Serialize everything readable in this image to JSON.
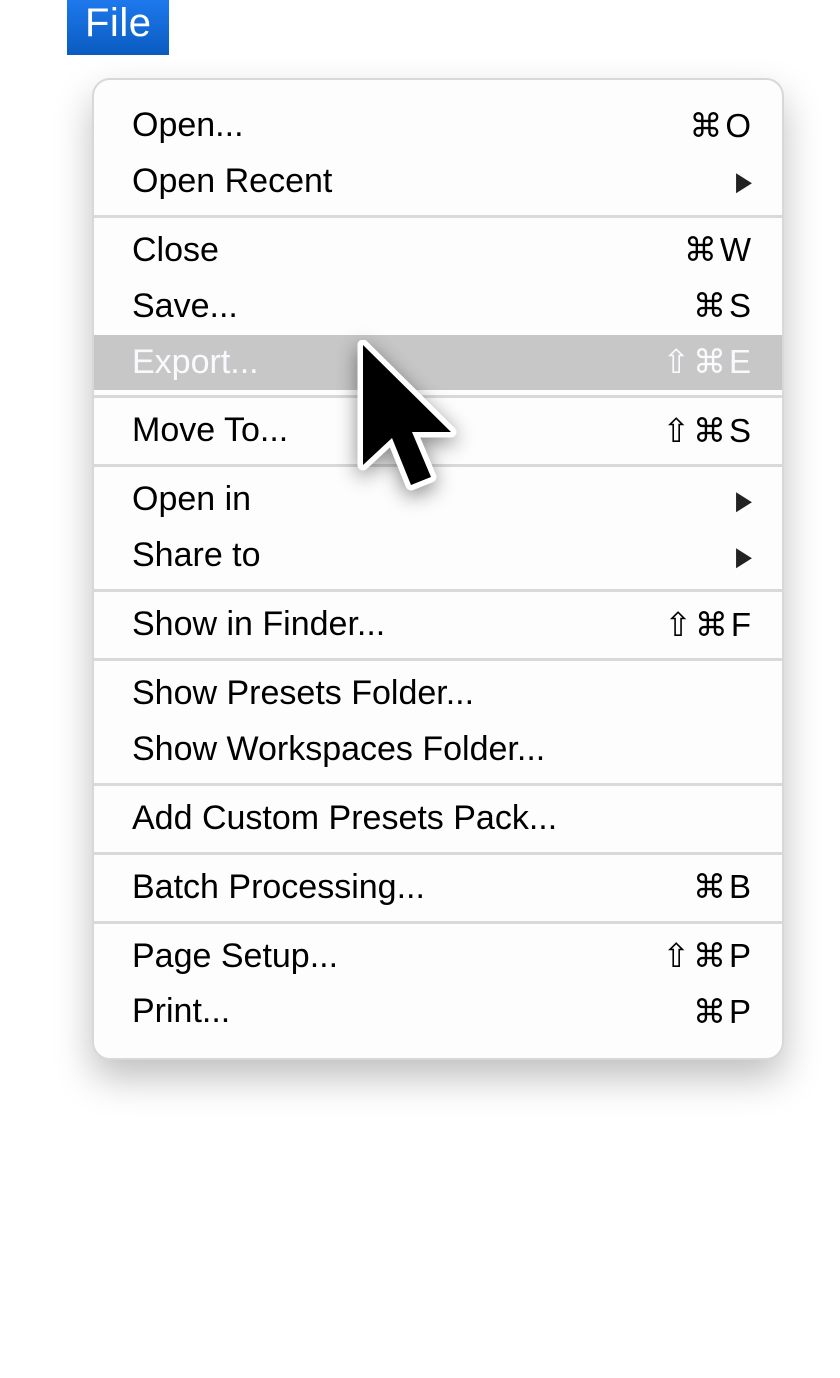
{
  "menu": {
    "title": "File",
    "groups": [
      [
        {
          "id": "open",
          "label": "Open...",
          "shortcut": "⌘O",
          "submenu": false
        },
        {
          "id": "open-recent",
          "label": "Open Recent",
          "shortcut": "",
          "submenu": true
        }
      ],
      [
        {
          "id": "close",
          "label": "Close",
          "shortcut": "⌘W",
          "submenu": false
        },
        {
          "id": "save",
          "label": "Save...",
          "shortcut": "⌘S",
          "submenu": false
        },
        {
          "id": "export",
          "label": "Export...",
          "shortcut": "⇧⌘E",
          "submenu": false,
          "highlight": true
        }
      ],
      [
        {
          "id": "move-to",
          "label": "Move To...",
          "shortcut": "⇧⌘S",
          "submenu": false
        }
      ],
      [
        {
          "id": "open-in",
          "label": "Open in",
          "shortcut": "",
          "submenu": true
        },
        {
          "id": "share-to",
          "label": "Share to",
          "shortcut": "",
          "submenu": true
        }
      ],
      [
        {
          "id": "show-in-finder",
          "label": "Show in Finder...",
          "shortcut": "⇧⌘F",
          "submenu": false
        }
      ],
      [
        {
          "id": "show-presets-folder",
          "label": "Show Presets Folder...",
          "shortcut": "",
          "submenu": false
        },
        {
          "id": "show-workspaces-folder",
          "label": "Show Workspaces Folder...",
          "shortcut": "",
          "submenu": false
        }
      ],
      [
        {
          "id": "add-custom-presets-pack",
          "label": "Add Custom Presets Pack...",
          "shortcut": "",
          "submenu": false
        }
      ],
      [
        {
          "id": "batch-processing",
          "label": "Batch Processing...",
          "shortcut": "⌘B",
          "submenu": false
        }
      ],
      [
        {
          "id": "page-setup",
          "label": "Page Setup...",
          "shortcut": "⇧⌘P",
          "submenu": false
        },
        {
          "id": "print",
          "label": "Print...",
          "shortcut": "⌘P",
          "submenu": false
        }
      ]
    ]
  }
}
